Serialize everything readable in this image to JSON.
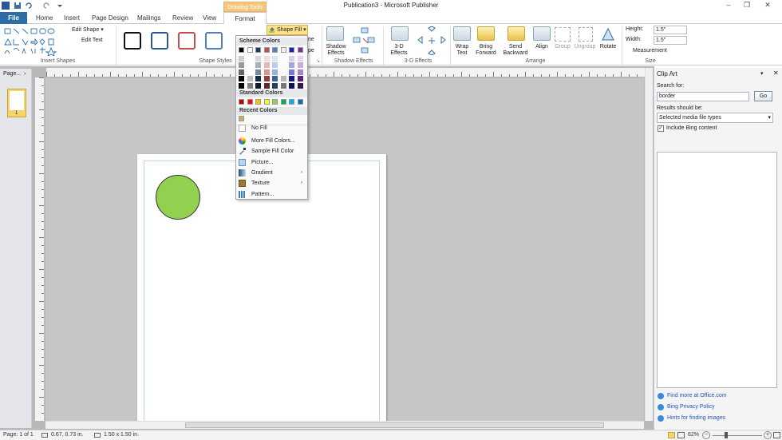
{
  "app": {
    "title": "Publication3 - Microsoft Publisher",
    "window_controls": [
      "–",
      "❐",
      "✕"
    ]
  },
  "tabs": {
    "file": "File",
    "items": [
      "Home",
      "Insert",
      "Page Design",
      "Mailings",
      "Review",
      "View"
    ],
    "contextual_header": "Drawing Tools",
    "format": "Format"
  },
  "ribbon": {
    "insert_shapes": {
      "edit_shape": "Edit Shape",
      "edit_text": "Edit Text",
      "label": "Insert Shapes"
    },
    "shape_styles": {
      "label": "Shape Styles",
      "shape_fill": "Shape Fill",
      "partial_1": "ne",
      "partial_2": "pe"
    },
    "shadow_effects": {
      "button": "Shadow Effects",
      "label": "Shadow Effects"
    },
    "three_d": {
      "button": "3-D Effects",
      "label": "3-D Effects"
    },
    "arrange": {
      "wrap_text": "Wrap Text",
      "bring_forward": "Bring Forward",
      "send_backward": "Send Backward",
      "align": "Align",
      "group": "Group",
      "ungroup": "Ungroup",
      "rotate": "Rotate",
      "label": "Arrange"
    },
    "size": {
      "height_label": "Height:",
      "height_value": "1.5\"",
      "width_label": "Width:",
      "width_value": "1.5\"",
      "measurement": "Measurement",
      "label": "Size"
    }
  },
  "pages_panel": {
    "title": "Page...",
    "page_number": "1"
  },
  "shape_fill_menu": {
    "scheme_header": "Scheme Colors",
    "standard_header": "Standard Colors",
    "recent_header": "Recent Colors",
    "scheme_top": [
      "#000000",
      "#ffffff",
      "#1f3a5a",
      "#c0504d",
      "#4f81bd",
      "#f2f2f2",
      "#1f1fb0",
      "#7030a0"
    ],
    "standard": [
      "#c00000",
      "#ff0000",
      "#ffc000",
      "#ffff00",
      "#92d050",
      "#00b050",
      "#00b0f0",
      "#0070c0"
    ],
    "recent": [
      "#c9b25a"
    ],
    "items": {
      "no_fill": "No Fill",
      "more_colors": "More Fill Colors...",
      "sample": "Sample Fill Color",
      "picture": "Picture...",
      "gradient": "Gradient",
      "texture": "Texture",
      "pattern": "Pattern..."
    }
  },
  "clip_art": {
    "title": "Clip Art",
    "search_label": "Search for:",
    "search_value": "border",
    "go": "Go",
    "results_label": "Results should be:",
    "results_value": "Selected media file types",
    "include_bing": "Include Bing content",
    "links": [
      "Find more at Office.com",
      "Bing Privacy Policy",
      "Hints for finding images"
    ]
  },
  "status": {
    "page": "Page: 1 of 1",
    "position": "0.67, 0.73 in.",
    "size": "1.50 x 1.50 in.",
    "zoom": "62%"
  },
  "colors": {
    "accent": "#2d6ea6",
    "shape_fill": "#92d050"
  }
}
